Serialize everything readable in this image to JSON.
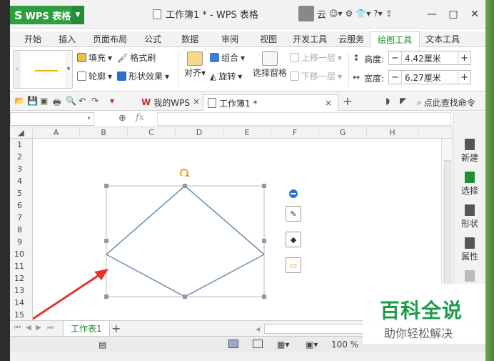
{
  "app": {
    "name": "WPS 表格",
    "logo_letter": "S"
  },
  "title": {
    "document": "工作簿1 * - WPS 表格",
    "user": "云"
  },
  "window_buttons": [
    "—",
    "□",
    "✕"
  ],
  "menu_tabs": [
    "开始",
    "插入",
    "页面布局",
    "公式",
    "数据",
    "审阅",
    "视图",
    "开发工具",
    "云服务",
    "绘图工具",
    "文本工具"
  ],
  "active_menu": "绘图工具",
  "ribbon": {
    "fill": "填充",
    "format_painter": "格式刷",
    "outline": "轮廓",
    "shape_effect": "形状效果",
    "align": "对齐",
    "group": "组合",
    "rotate": "旋转",
    "selection_pane": "选择窗格",
    "bring_forward": "上移一层",
    "send_backward": "下移一层",
    "height_label": "高度:",
    "height_value": "4.42厘米",
    "width_label": "宽度:",
    "width_value": "6.27厘米",
    "minus": "−",
    "plus": "+"
  },
  "doc_tabs": {
    "wps": "我的WPS",
    "wps_glyph": "W",
    "book": "工作簿1 *",
    "close": "×",
    "add": "+",
    "search": "点此查找命令"
  },
  "formula": {
    "fx": "fx"
  },
  "columns": [
    "A",
    "B",
    "C",
    "D",
    "E",
    "F",
    "G",
    "H"
  ],
  "rows": [
    "1",
    "2",
    "3",
    "4",
    "5",
    "6",
    "7",
    "8",
    "9",
    "10",
    "11",
    "12",
    "13",
    "14",
    "15"
  ],
  "right_panel": [
    "新建",
    "选择",
    "形状",
    "属性"
  ],
  "sheet": {
    "name": "工作表1",
    "add": "+"
  },
  "status": {
    "zoom": "100 %"
  },
  "watermark": {
    "main": "百科全说",
    "sub": "助你轻松解决"
  },
  "colors": {
    "accent": "#1b8f2f",
    "shape_line": "#6a8fb8",
    "arrow": "#e33333",
    "rotate_handle": "#f0a020",
    "watermark": "#1c9b4a"
  }
}
